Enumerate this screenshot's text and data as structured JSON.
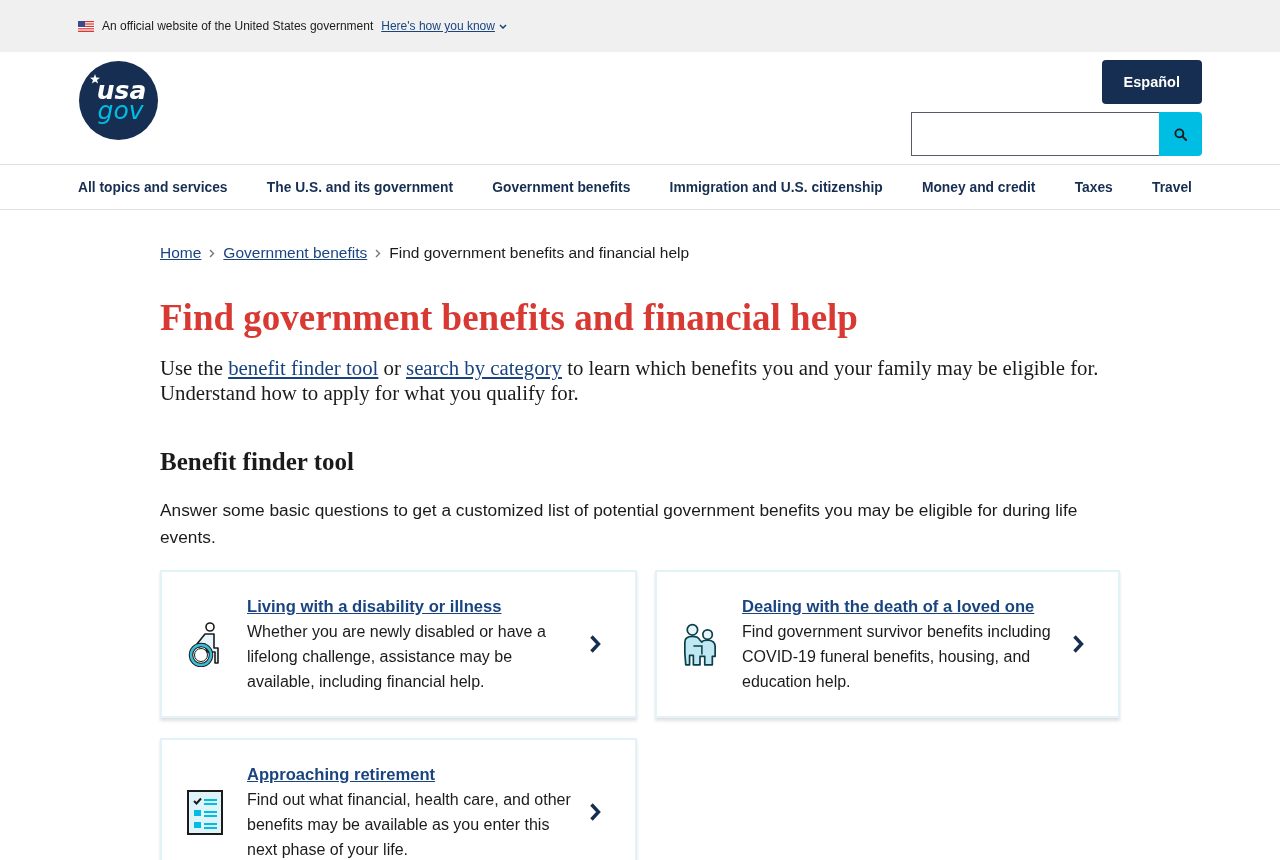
{
  "gov_banner": {
    "text": "An official website of the United States government",
    "link": "Here's how you know"
  },
  "logo": {
    "line_1": "usa",
    "line_2": "gov"
  },
  "language_button": "Español",
  "nav": [
    "All topics and services",
    "The U.S. and its government",
    "Government benefits",
    "Immigration and U.S. citizenship",
    "Money and credit",
    "Taxes",
    "Travel"
  ],
  "breadcrumb": [
    {
      "label": "Home",
      "kind": "link"
    },
    {
      "label": "Government benefits",
      "kind": "link"
    },
    {
      "label": "Find government benefits and financial help",
      "kind": "current"
    }
  ],
  "title": "Find government benefits and financial help",
  "intro": [
    {
      "kind": "text",
      "text": "Use the "
    },
    {
      "kind": "link",
      "text": "benefit finder tool"
    },
    {
      "kind": "text",
      "text": " or "
    },
    {
      "kind": "link",
      "text": "search by category"
    },
    {
      "kind": "text",
      "text": " to learn which benefits you and your family may be eligible for. Understand how to apply for what you qualify for."
    }
  ],
  "section": {
    "heading": "Benefit finder tool",
    "description": "Answer some basic questions to get a customized list of potential government benefits you may be eligible for during life events.",
    "cards": [
      {
        "kind": "wheelchair",
        "title": "Living with a disability or illness",
        "description": "Whether you are newly disabled or have a lifelong challenge, assistance may be available, including financial help."
      },
      {
        "kind": "family",
        "title": "Dealing with the death of a loved one",
        "description": "Find government survivor benefits including COVID-19 funeral benefits, housing, and education help."
      },
      {
        "kind": "checklist",
        "title": "Approaching retirement",
        "description": "Find out what financial, health care, and other benefits may be available as you enter this next phase of your life."
      }
    ]
  }
}
